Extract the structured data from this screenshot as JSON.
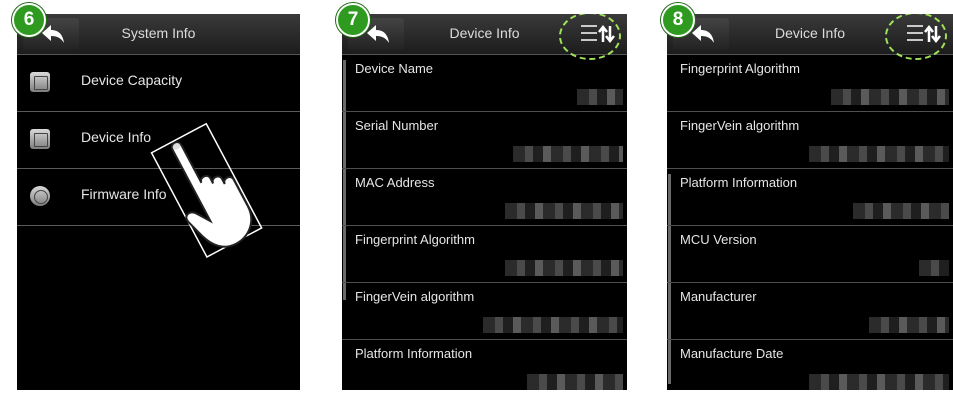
{
  "steps": [
    "6",
    "7",
    "8"
  ],
  "colors": {
    "step_badge": "#2e9a1f",
    "highlight_circle": "#9fe05a",
    "screen_bg": "#000000"
  },
  "screen1": {
    "title": "System Info",
    "items": [
      {
        "label": "Device Capacity",
        "icon": "capacity-icon"
      },
      {
        "label": "Device Info",
        "icon": "device-info-icon"
      },
      {
        "label": "Firmware Info",
        "icon": "firmware-icon"
      }
    ],
    "gesture": "tap-hand-icon"
  },
  "screen2": {
    "title": "Device Info",
    "rows": [
      "Device Name",
      "Serial Number",
      "MAC Address",
      "Fingerprint Algorithm",
      "FingerVein algorithm",
      "Platform Information"
    ]
  },
  "screen3": {
    "title": "Device Info",
    "rows": [
      "Fingerprint Algorithm",
      "FingerVein algorithm",
      "Platform Information",
      "MCU Version",
      "Manufacturer",
      "Manufacture Date"
    ]
  }
}
